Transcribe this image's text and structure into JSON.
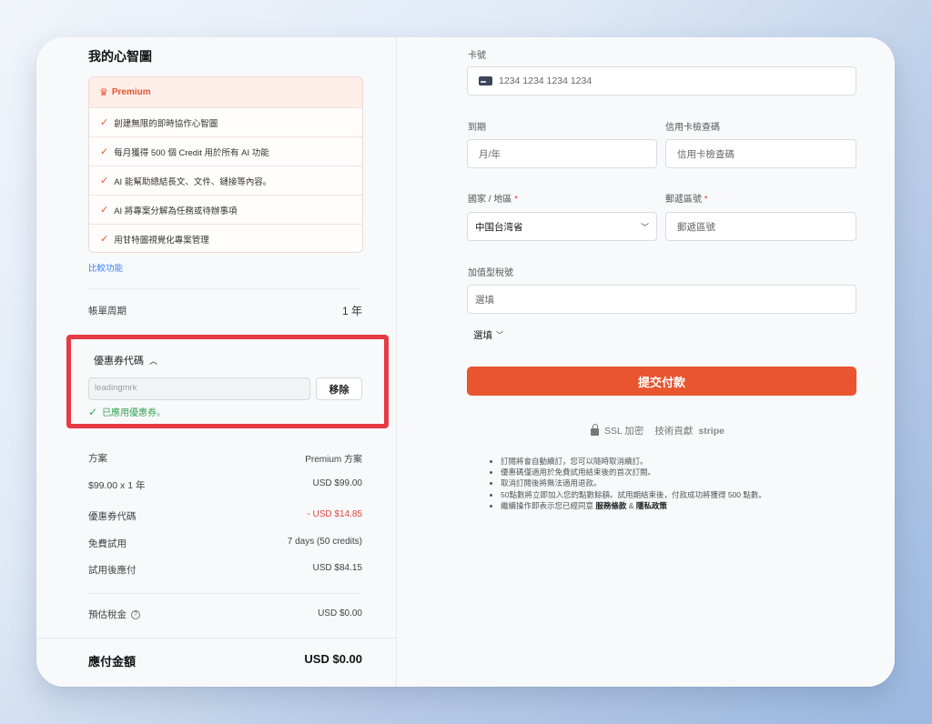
{
  "title": "我的心智圖",
  "plan": {
    "name": "Premium",
    "features": [
      "創建無限的即時協作心智圖",
      "每月獲得 500 個 Credit 用於所有 AI 功能",
      "AI 能幫助總結長文、文件、鏈接等內容。",
      "AI 將專案分解為任務或待辦事項",
      "用甘特圖視覺化專案管理"
    ],
    "compare_link": "比較功能"
  },
  "billing": {
    "label": "帳單周期",
    "value": "1 年"
  },
  "coupon": {
    "toggle_label": "優惠券代碼",
    "value": "leadingmrk",
    "remove_label": "移除",
    "applied_text": "已應用優惠券。"
  },
  "summary": [
    {
      "label": "方案",
      "value": "Premium 方案",
      "color": "#444"
    },
    {
      "label": "$99.00 x 1 年",
      "value": "USD $99.00",
      "color": "#444"
    },
    {
      "label": "優惠券代碼",
      "value": "- USD $14.85",
      "color": "#e0453b"
    },
    {
      "label": "免費試用",
      "value": "7 days (50 credits)",
      "color": "#444"
    },
    {
      "label": "試用後應付",
      "value": "USD $84.15",
      "color": "#444"
    }
  ],
  "tax": {
    "label": "預估稅金",
    "value": "USD $0.00"
  },
  "total": {
    "label": "應付金額",
    "value": "USD $0.00"
  },
  "form": {
    "card_label": "卡號",
    "card_placeholder": "1234 1234 1234 1234",
    "expiry_label": "到期",
    "expiry_placeholder": "月/年",
    "cvc_label": "信用卡檢查碼",
    "cvc_placeholder": "信用卡檢查碼",
    "country_label": "國家 / 地區",
    "country_value": "中国台湾省",
    "zip_label": "郵遞區號",
    "zip_placeholder": "郵遞區號",
    "vat_label": "加值型稅號",
    "vat_placeholder": "選填",
    "optional_label": "選填",
    "submit_label": "提交付款",
    "secure_text": "SSL 加密",
    "powered_text": "技術貢獻",
    "powered_brand": "stripe",
    "required_mark": "*"
  },
  "notes": [
    "訂閱將會自動續訂，您可以隨時取消續訂。",
    "優惠碼僅適用於免費試用結束後的首次訂閱。",
    "取消訂閱後將無法適用退款。",
    "50點數將立即加入您的點數餘額。試用期結束後，付款成功將獲得 500 點數。"
  ],
  "legal": {
    "prefix": "繼續操作即表示您已經同意",
    "terms": "服務條款",
    "amp": "&",
    "privacy": "隱私政策"
  },
  "colors": {
    "accent": "#e8552f",
    "highlight": "#e63a45",
    "success": "#3aa457",
    "link": "#3b82f6"
  }
}
